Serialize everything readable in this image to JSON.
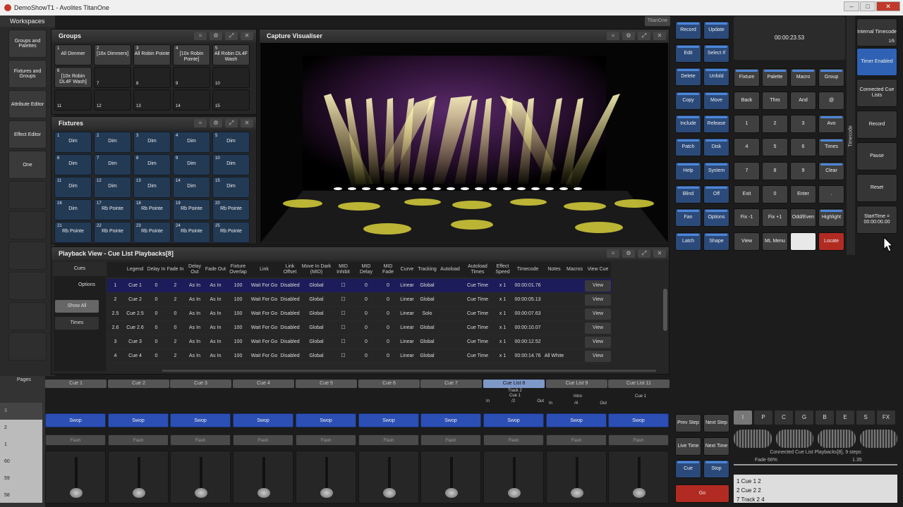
{
  "window": {
    "title": "DemoShowT1 - Avolites TitanOne"
  },
  "workspaces": {
    "title": "Workspaces",
    "items": [
      "Groups and Palettes",
      "Fixtures and Groups",
      "Attribute Editor",
      "Effect Editor",
      "One"
    ]
  },
  "titanone_tab": "TitanOne",
  "groups": {
    "title": "Groups",
    "tiles": [
      {
        "n": "1",
        "l": "All Dimmer"
      },
      {
        "n": "2",
        "l": "[16x Dimmers]"
      },
      {
        "n": "3",
        "l": "All Robin Pointe"
      },
      {
        "n": "4",
        "l": "[10x Robin Pointe]"
      },
      {
        "n": "5",
        "l": "All Robin DL4F Wash"
      },
      {
        "n": "6",
        "l": "[10x Robin DL4F Wash]"
      },
      {
        "n": "7",
        "l": ""
      },
      {
        "n": "8",
        "l": ""
      },
      {
        "n": "9",
        "l": ""
      },
      {
        "n": "10",
        "l": ""
      },
      {
        "n": "11",
        "l": ""
      },
      {
        "n": "12",
        "l": ""
      },
      {
        "n": "13",
        "l": ""
      },
      {
        "n": "14",
        "l": ""
      },
      {
        "n": "15",
        "l": ""
      }
    ]
  },
  "fixtures": {
    "title": "Fixtures",
    "tiles": [
      {
        "n": "1",
        "l": "Dim"
      },
      {
        "n": "2",
        "l": "Dim"
      },
      {
        "n": "3",
        "l": "Dim"
      },
      {
        "n": "4",
        "l": "Dim"
      },
      {
        "n": "5",
        "l": "Dim"
      },
      {
        "n": "6",
        "l": "Dim"
      },
      {
        "n": "7",
        "l": "Dim"
      },
      {
        "n": "8",
        "l": "Dim"
      },
      {
        "n": "9",
        "l": "Dim"
      },
      {
        "n": "10",
        "l": "Dim"
      },
      {
        "n": "11",
        "l": "Dim"
      },
      {
        "n": "12",
        "l": "Dim"
      },
      {
        "n": "13",
        "l": "Dim"
      },
      {
        "n": "14",
        "l": "Dim"
      },
      {
        "n": "15",
        "l": "Dim"
      },
      {
        "n": "16",
        "l": "Dim"
      },
      {
        "n": "17",
        "l": "Rb Pointe"
      },
      {
        "n": "18",
        "l": "Rb Pointe"
      },
      {
        "n": "19",
        "l": "Rb Pointe"
      },
      {
        "n": "20",
        "l": "Rb Pointe"
      },
      {
        "n": "21",
        "l": "Rb Pointe"
      },
      {
        "n": "22",
        "l": "Rb Pointe"
      },
      {
        "n": "23",
        "l": "Rb Pointe"
      },
      {
        "n": "24",
        "l": "Rb Pointe"
      },
      {
        "n": "25",
        "l": "Rb Pointe"
      }
    ]
  },
  "visualiser": {
    "title": "Capture Visualiser"
  },
  "command_keys": [
    [
      "Record",
      "Update"
    ],
    [
      "Edit",
      "Select If"
    ],
    [
      "Delete",
      "Unfold"
    ],
    [
      "Copy",
      "Move"
    ],
    [
      "Include",
      "Release"
    ],
    [
      "Patch",
      "Disk"
    ],
    [
      "Help",
      "System"
    ],
    [
      "Blind",
      "Off"
    ],
    [
      "Fan",
      "Options"
    ],
    [
      "Latch",
      "Shape"
    ]
  ],
  "timecode_display": "00:00:23.53",
  "keypad": [
    [
      "Fixture",
      "Palette",
      "Macro",
      "Group"
    ],
    [
      "Back",
      "Thro",
      "And",
      "@"
    ],
    [
      "1",
      "2",
      "3",
      "Avo"
    ],
    [
      "4",
      "5",
      "6",
      "Times"
    ],
    [
      "7",
      "8",
      "9",
      "Clear"
    ],
    [
      "Exit",
      "0",
      "Enter",
      "."
    ],
    [
      "Fix -1",
      "Fix +1",
      "Odd/Even",
      "Highlight"
    ],
    [
      "View",
      "ML Menu",
      "",
      "Locate"
    ]
  ],
  "timecode_side": {
    "label": "Timecode",
    "internal": "Internal Timecode",
    "page": "1/5",
    "timer_enabled": "Timer Enabled",
    "connected": "Connected Cue Lists",
    "record": "Record",
    "pause": "Pause",
    "reset": "Reset",
    "start_time": "StartTime = 00:00:00.00"
  },
  "playback": {
    "title": "Playback View - Cue List Playbacks[8]",
    "side": {
      "cues": "Cues",
      "options": "Options",
      "show_all": "Show All",
      "times": "Times"
    },
    "columns": [
      "",
      "Legend",
      "Delay In",
      "Fade In",
      "Delay Out",
      "Fade Out",
      "Fixture Overlap",
      "Link",
      "Link Offset",
      "Move In Dark (MID)",
      "MID Inhibit",
      "MID Delay",
      "MID Fade",
      "Curve",
      "Tracking",
      "Autoload",
      "Autoload Times",
      "Effect Speed",
      "Timecode",
      "Notes",
      "Macros",
      "View Cue"
    ],
    "rows": [
      [
        "1",
        "Cue 1",
        "0",
        "2",
        "As In",
        "As In",
        "100",
        "Wait For Go",
        "Disabled",
        "Global",
        "☐",
        "0",
        "0",
        "Linear",
        "Global",
        "",
        "Cue Time",
        "x 1",
        "00:00:01.76",
        "",
        "",
        "View"
      ],
      [
        "2",
        "Cue 2",
        "0",
        "2",
        "As In",
        "As In",
        "100",
        "Wait For Go",
        "Disabled",
        "Global",
        "☐",
        "0",
        "0",
        "Linear",
        "Global",
        "",
        "Cue Time",
        "x 1",
        "00:00:05.13",
        "",
        "",
        "View"
      ],
      [
        "2.5",
        "Cue 2.5",
        "0",
        "0",
        "As In",
        "As In",
        "100",
        "Wait For Go",
        "Disabled",
        "Global",
        "☐",
        "0",
        "0",
        "Linear",
        "Solo",
        "",
        "Cue Time",
        "x 1",
        "00:00:07.63",
        "",
        "",
        "View"
      ],
      [
        "2.6",
        "Cue 2.6",
        "0",
        "0",
        "As In",
        "As In",
        "100",
        "Wait For Go",
        "Disabled",
        "Global",
        "☐",
        "0",
        "0",
        "Linear",
        "Global",
        "",
        "Cue Time",
        "x 1",
        "00:00:10.07",
        "",
        "",
        "View"
      ],
      [
        "3",
        "Cue 3",
        "0",
        "2",
        "As In",
        "As In",
        "100",
        "Wait For Go",
        "Disabled",
        "Global",
        "☐",
        "0",
        "0",
        "Linear",
        "Global",
        "",
        "Cue Time",
        "x 1",
        "00:00:12.52",
        "",
        "",
        "View"
      ],
      [
        "4",
        "Cue 4",
        "0",
        "2",
        "As In",
        "As In",
        "100",
        "Wait For Go",
        "Disabled",
        "Global",
        "☐",
        "0",
        "0",
        "Linear",
        "Global",
        "",
        "Cue Time",
        "x 1",
        "00:00:14.76",
        "All White",
        "",
        "View"
      ]
    ]
  },
  "pages": {
    "label": "Pages",
    "numbers": [
      "3",
      "2",
      "1",
      "60",
      "59",
      "58"
    ]
  },
  "playbacks": {
    "names": [
      "Cue 1",
      "Cue 2",
      "Cue 3",
      "Cue 4",
      "Cue 5",
      "Cue 6",
      "Cue 7",
      "Cue List 8",
      "Cue List 9",
      "Cue List 11"
    ],
    "swop": "Swop",
    "flash": "Flash",
    "pb8": {
      "track": "Track 2",
      "cue": "Cue 1",
      "in": "In",
      "count": "/2",
      "out": "Out"
    },
    "pb9": {
      "cue": "Intro",
      "in": "In",
      "count": "/4",
      "out": "Out"
    },
    "pb11": {
      "cue": "Cue 1"
    }
  },
  "cue_controls": {
    "prev_step": "Prev Step",
    "next_step": "Next Step",
    "live_time": "Live Time",
    "next_time": "Next Time",
    "cue": "Cue",
    "stop": "Stop",
    "go": "Go"
  },
  "attribute_tabs": [
    "I",
    "P",
    "C",
    "G",
    "B",
    "E",
    "S",
    "FX"
  ],
  "status": {
    "connected": "Connected Cue List Playbacks[8], 9 steps",
    "fade": "Fade 66%",
    "value": "1.35",
    "list": [
      "1  Cue 1  2",
      "2  Cue 2  2",
      "7  Track 2  4"
    ]
  }
}
